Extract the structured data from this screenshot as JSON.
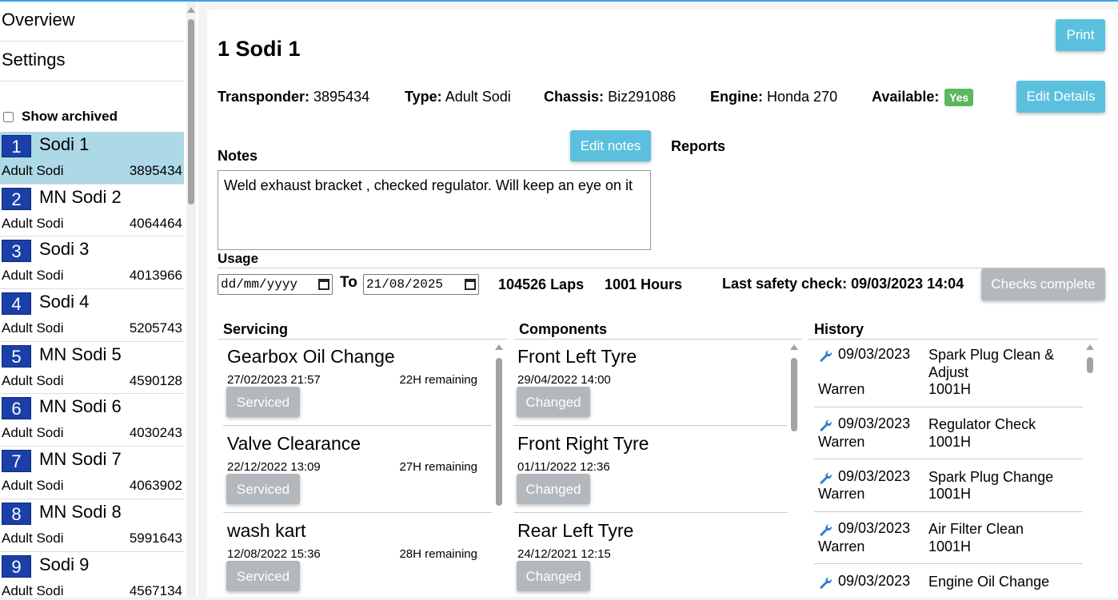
{
  "sidebar": {
    "nav": [
      {
        "label": "Overview"
      },
      {
        "label": "Settings"
      }
    ],
    "show_archived_label": "Show archived",
    "karts": [
      {
        "num": "1",
        "name": "Sodi 1",
        "type": "Adult Sodi",
        "transponder": "3895434"
      },
      {
        "num": "2",
        "name": "MN Sodi 2",
        "type": "Adult Sodi",
        "transponder": "4064464"
      },
      {
        "num": "3",
        "name": "Sodi 3",
        "type": "Adult Sodi",
        "transponder": "4013966"
      },
      {
        "num": "4",
        "name": "Sodi 4",
        "type": "Adult Sodi",
        "transponder": "5205743"
      },
      {
        "num": "5",
        "name": "MN Sodi 5",
        "type": "Adult Sodi",
        "transponder": "4590128"
      },
      {
        "num": "6",
        "name": "MN Sodi 6",
        "type": "Adult Sodi",
        "transponder": "4030243"
      },
      {
        "num": "7",
        "name": "MN Sodi 7",
        "type": "Adult Sodi",
        "transponder": "4063902"
      },
      {
        "num": "8",
        "name": "MN Sodi 8",
        "type": "Adult Sodi",
        "transponder": "5991643"
      },
      {
        "num": "9",
        "name": "Sodi 9",
        "type": "Adult Sodi",
        "transponder": "4567134"
      }
    ]
  },
  "main": {
    "title": "1 Sodi 1",
    "print_label": "Print",
    "edit_details_label": "Edit Details",
    "details": {
      "transponder_label": "Transponder:",
      "transponder": "3895434",
      "type_label": "Type:",
      "type": "Adult Sodi",
      "chassis_label": "Chassis:",
      "chassis": "Biz291086",
      "engine_label": "Engine:",
      "engine": "Honda 270",
      "available_label": "Available:",
      "available": "Yes"
    },
    "notes_label": "Notes",
    "edit_notes_label": "Edit notes",
    "reports_label": "Reports",
    "notes_text": "Weld exhaust bracket , checked regulator. Will keep an eye on it",
    "usage": {
      "label": "Usage",
      "from_value": "dd/mm/yyyy",
      "to_label": "To",
      "to_value": "21/08/2025",
      "laps": "104526 Laps",
      "hours": "1001 Hours",
      "last_safety_check": "Last safety check: 09/03/2023 14:04",
      "checks_complete_label": "Checks complete"
    },
    "servicing": {
      "heading": "Servicing",
      "items": [
        {
          "name": "Gearbox Oil Change",
          "date": "27/02/2023 21:57",
          "remaining": "22H remaining",
          "button": "Serviced"
        },
        {
          "name": "Valve Clearance",
          "date": "22/12/2022 13:09",
          "remaining": "27H remaining",
          "button": "Serviced"
        },
        {
          "name": "wash kart",
          "date": "12/08/2022 15:36",
          "remaining": "28H remaining",
          "button": "Serviced"
        }
      ]
    },
    "components": {
      "heading": "Components",
      "items": [
        {
          "name": "Front Left Tyre",
          "date": "29/04/2022 14:00",
          "button": "Changed"
        },
        {
          "name": "Front Right Tyre",
          "date": "01/11/2022 12:36",
          "button": "Changed"
        },
        {
          "name": "Rear Left Tyre",
          "date": "24/12/2021 12:15",
          "button": "Changed"
        }
      ]
    },
    "history": {
      "heading": "History",
      "items": [
        {
          "date": "09/03/2023",
          "desc": "Spark Plug Clean & Adjust",
          "user": "Warren",
          "hours": "1001H"
        },
        {
          "date": "09/03/2023",
          "desc": "Regulator Check",
          "user": "Warren",
          "hours": "1001H"
        },
        {
          "date": "09/03/2023",
          "desc": "Spark Plug Change",
          "user": "Warren",
          "hours": "1001H"
        },
        {
          "date": "09/03/2023",
          "desc": "Air Filter Clean",
          "user": "Warren",
          "hours": "1001H"
        },
        {
          "date": "09/03/2023",
          "desc": "Engine Oil Change",
          "user": "",
          "hours": ""
        }
      ]
    }
  },
  "colors": {
    "accent": "#5bc0de",
    "selected": "#add8e6",
    "badge": "#5cb85c",
    "kart_num": "#1a3fa8",
    "grey_button": "#b3b8bd"
  },
  "icons": {
    "history": "wrench-icon",
    "date": "calendar-icon"
  }
}
